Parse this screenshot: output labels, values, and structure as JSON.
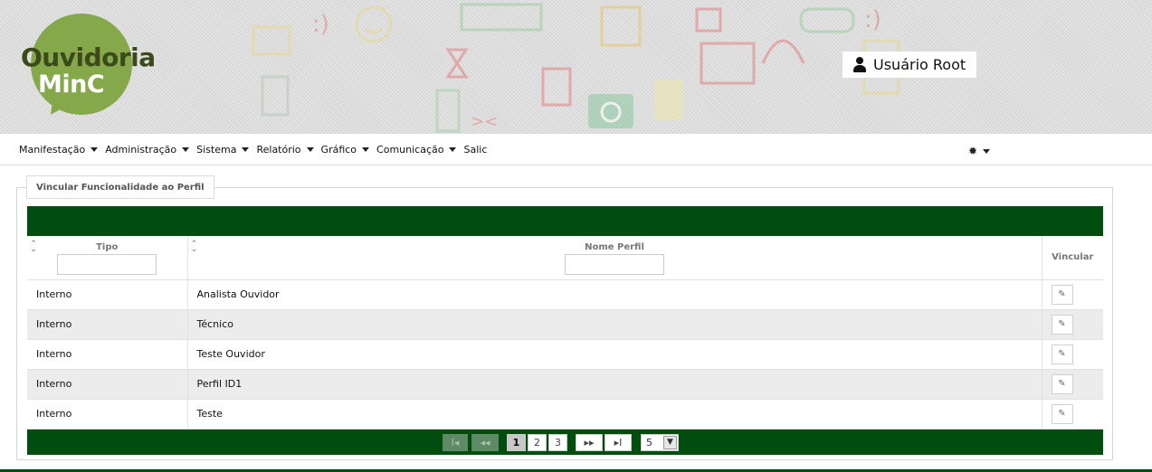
{
  "header": {
    "logo_line1": "Ouvidoria",
    "logo_line2": "MinC",
    "user_name": "Usuário Root"
  },
  "menu": {
    "items": [
      {
        "label": "Manifestação",
        "has_dropdown": true
      },
      {
        "label": "Administração",
        "has_dropdown": true
      },
      {
        "label": "Sistema",
        "has_dropdown": true
      },
      {
        "label": "Relatório",
        "has_dropdown": true
      },
      {
        "label": "Gráfico",
        "has_dropdown": true
      },
      {
        "label": "Comunicação",
        "has_dropdown": true
      },
      {
        "label": "Salic",
        "has_dropdown": false
      }
    ],
    "settings_icon": "gear-icon"
  },
  "panel": {
    "legend": "Vincular Funcionalidade ao Perfil",
    "columns": {
      "tipo": "Tipo",
      "nome_perfil": "Nome Perfil",
      "vincular": "Vincular"
    },
    "filters": {
      "tipo": "",
      "nome_perfil": ""
    },
    "rows": [
      {
        "tipo": "Interno",
        "nome": "Analista Ouvidor"
      },
      {
        "tipo": "Interno",
        "nome": "Técnico"
      },
      {
        "tipo": "Interno",
        "nome": "Teste Ouvidor"
      },
      {
        "tipo": "Interno",
        "nome": "Perfil ID1"
      },
      {
        "tipo": "Interno",
        "nome": "Teste"
      }
    ],
    "paginator": {
      "first": "I◂",
      "prev": "◂◂",
      "pages": [
        "1",
        "2",
        "3"
      ],
      "current_page": "1",
      "next": "▸▸",
      "last": "▸I",
      "rows_per_page": "5"
    }
  },
  "colors": {
    "brand_green": "#004d10",
    "logo_green": "#85a84a"
  }
}
